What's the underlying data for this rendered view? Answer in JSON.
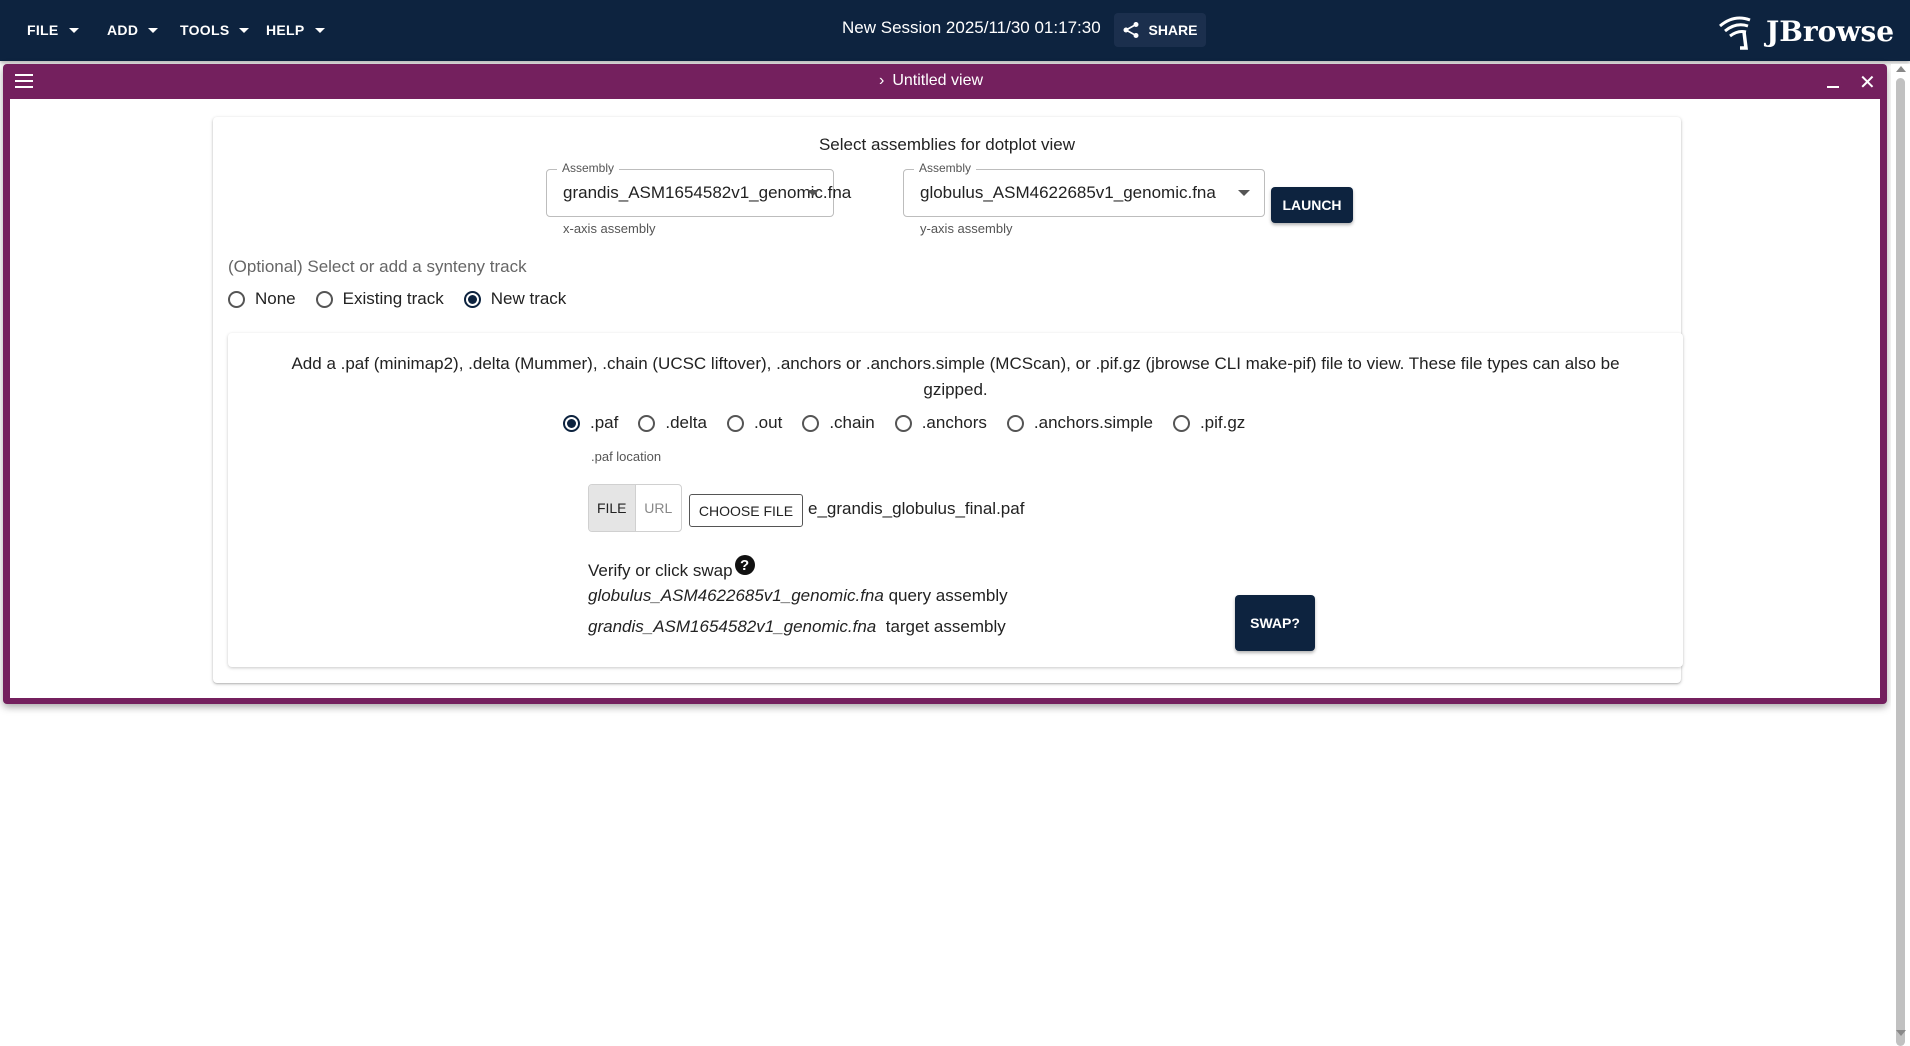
{
  "menu": {
    "file": "FILE",
    "add": "ADD",
    "tools": "TOOLS",
    "help": "HELP"
  },
  "session": {
    "title": "New Session 2025/11/30 01:17:30",
    "share_label": "SHARE"
  },
  "logo": {
    "text": "JBrowse"
  },
  "view": {
    "title": "Untitled view"
  },
  "dotplot": {
    "heading": "Select assemblies for dotplot view",
    "x_assembly": {
      "label": "Assembly",
      "value": "grandis_ASM1654582v1_genomic.fna",
      "helper": "x-axis assembly"
    },
    "y_assembly": {
      "label": "Assembly",
      "value": "globulus_ASM4622685v1_genomic.fna",
      "helper": "y-axis assembly"
    },
    "launch_label": "LAUNCH",
    "optional_label": "(Optional) Select or add a synteny track",
    "track_options": [
      "None",
      "Existing track",
      "New track"
    ],
    "track_selected": "New track"
  },
  "new_track": {
    "description": "Add a .paf (minimap2), .delta (Mummer), .chain (UCSC liftover), .anchors or .anchors.simple (MCScan), or .pif.gz (jbrowse CLI make-pif) file to view. These file types can also be gzipped.",
    "formats": [
      ".paf",
      ".delta",
      ".out",
      ".chain",
      ".anchors",
      ".anchors.simple",
      ".pif.gz"
    ],
    "format_selected": ".paf",
    "location_label": ".paf location",
    "toggle_file": "FILE",
    "toggle_url": "URL",
    "choose_file_label": "CHOOSE FILE",
    "file_name": "e_grandis_globulus_final.paf",
    "verify_label": "Verify or click swap",
    "help_glyph": "?",
    "query_assembly": "globulus_ASM4622685v1_genomic.fna",
    "query_suffix": "query assembly",
    "target_assembly": "grandis_ASM1654582v1_genomic.fna",
    "target_suffix": "target assembly",
    "swap_label": "SWAP?"
  },
  "colors": {
    "appbar": "#0d233f",
    "view_frame": "#74205e",
    "primary": "#0d233f"
  },
  "icons": {
    "menu_caret": "caret-down-icon",
    "share": "share-icon",
    "logo": "jbrowse-logo-icon",
    "view_menu": "hamburger-menu-icon",
    "expand": "chevron-right-icon",
    "minimize": "minimize-icon",
    "close": "close-icon",
    "help": "help-circle-icon"
  }
}
